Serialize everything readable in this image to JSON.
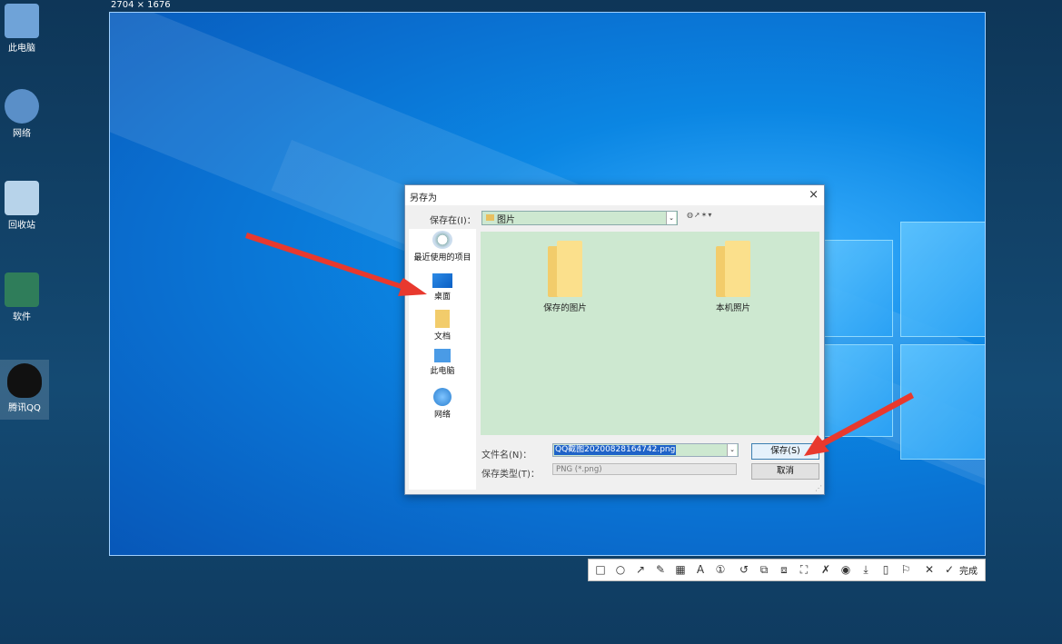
{
  "screen_size_label": "2704 × 1676",
  "desktop_icons": [
    {
      "label": "此电脑",
      "color": "#6fa3d8"
    },
    {
      "label": "网络",
      "color": "#5a8fc8"
    },
    {
      "label": "回收站",
      "color": "#b7d3ea"
    },
    {
      "label": "软件",
      "color": "#2f7d5a"
    },
    {
      "label": "腾讯QQ",
      "color": "#111111"
    }
  ],
  "dialog": {
    "title": "另存为",
    "close": "×",
    "look_in_label": "保存在(I)：",
    "look_in_value": "图片",
    "dropdown_arrow": "⌄",
    "toolbar_icons": "◍➚✶▾",
    "places": [
      {
        "label": "最近使用的项目",
        "icon": "clock-icon"
      },
      {
        "label": "桌面",
        "icon": "desktop-icon"
      },
      {
        "label": "文档",
        "icon": "documents-icon"
      },
      {
        "label": "此电脑",
        "icon": "computer-icon"
      },
      {
        "label": "网络",
        "icon": "network-icon"
      }
    ],
    "folders": [
      {
        "label": "保存的图片"
      },
      {
        "label": "本机照片"
      }
    ],
    "filename_label": "文件名(N)：",
    "filename_value": "QQ截图20200828164742.png",
    "filetype_label": "保存类型(T)：",
    "filetype_value": "PNG (*.png)",
    "save_button": "保存(S)",
    "cancel_button": "取消",
    "resize_grip": "⋰"
  },
  "screenshot_toolbar": {
    "tools": [
      "□",
      "○",
      "↗",
      "✎",
      "▦",
      "A",
      "①",
      "↺",
      "⧉",
      "⧈",
      "⛶",
      "✗",
      "◉",
      "⤓",
      "▯",
      "⚐",
      "✕",
      "✓"
    ],
    "done_label": "完成"
  },
  "colors": {
    "arrow": "#e8392e",
    "content_bg": "#cde8d0",
    "accent": "#1f63c8"
  }
}
